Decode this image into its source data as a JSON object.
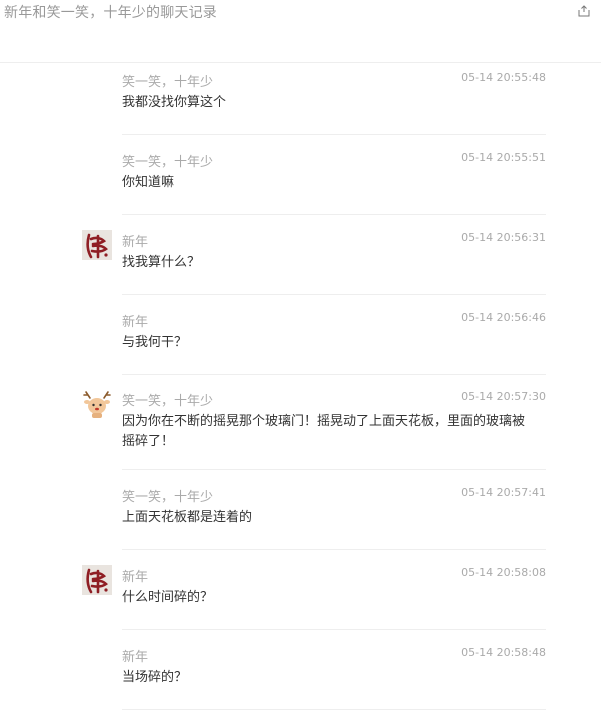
{
  "header": {
    "title": "新年和笑一笑，十年少的聊天记录",
    "share_icon": "share-icon"
  },
  "messages": [
    {
      "sender": "笑一笑，十年少",
      "time": "05-14 20:55:48",
      "text": "我都没找你算这个",
      "avatar": "none"
    },
    {
      "sender": "笑一笑，十年少",
      "time": "05-14 20:55:51",
      "text": "你知道嘛",
      "avatar": "none"
    },
    {
      "sender": "新年",
      "time": "05-14 20:56:31",
      "text": "找我算什么？",
      "avatar": "calligraphy-avatar"
    },
    {
      "sender": "新年",
      "time": "05-14 20:56:46",
      "text": "与我何干？",
      "avatar": "none"
    },
    {
      "sender": "笑一笑，十年少",
      "time": "05-14 20:57:30",
      "text": "因为你在不断的摇晃那个玻璃门！摇晃动了上面天花板，里面的玻璃被摇碎了！",
      "avatar": "deer-avatar"
    },
    {
      "sender": "笑一笑，十年少",
      "time": "05-14 20:57:41",
      "text": "上面天花板都是连着的",
      "avatar": "none"
    },
    {
      "sender": "新年",
      "time": "05-14 20:58:08",
      "text": "什么时间碎的？",
      "avatar": "calligraphy-avatar"
    },
    {
      "sender": "新年",
      "time": "05-14 20:58:48",
      "text": "当场碎的？",
      "avatar": "none"
    }
  ],
  "colors": {
    "meta_text": "#aaaaaa",
    "body_text": "#333333",
    "divider": "#eeeeee"
  }
}
